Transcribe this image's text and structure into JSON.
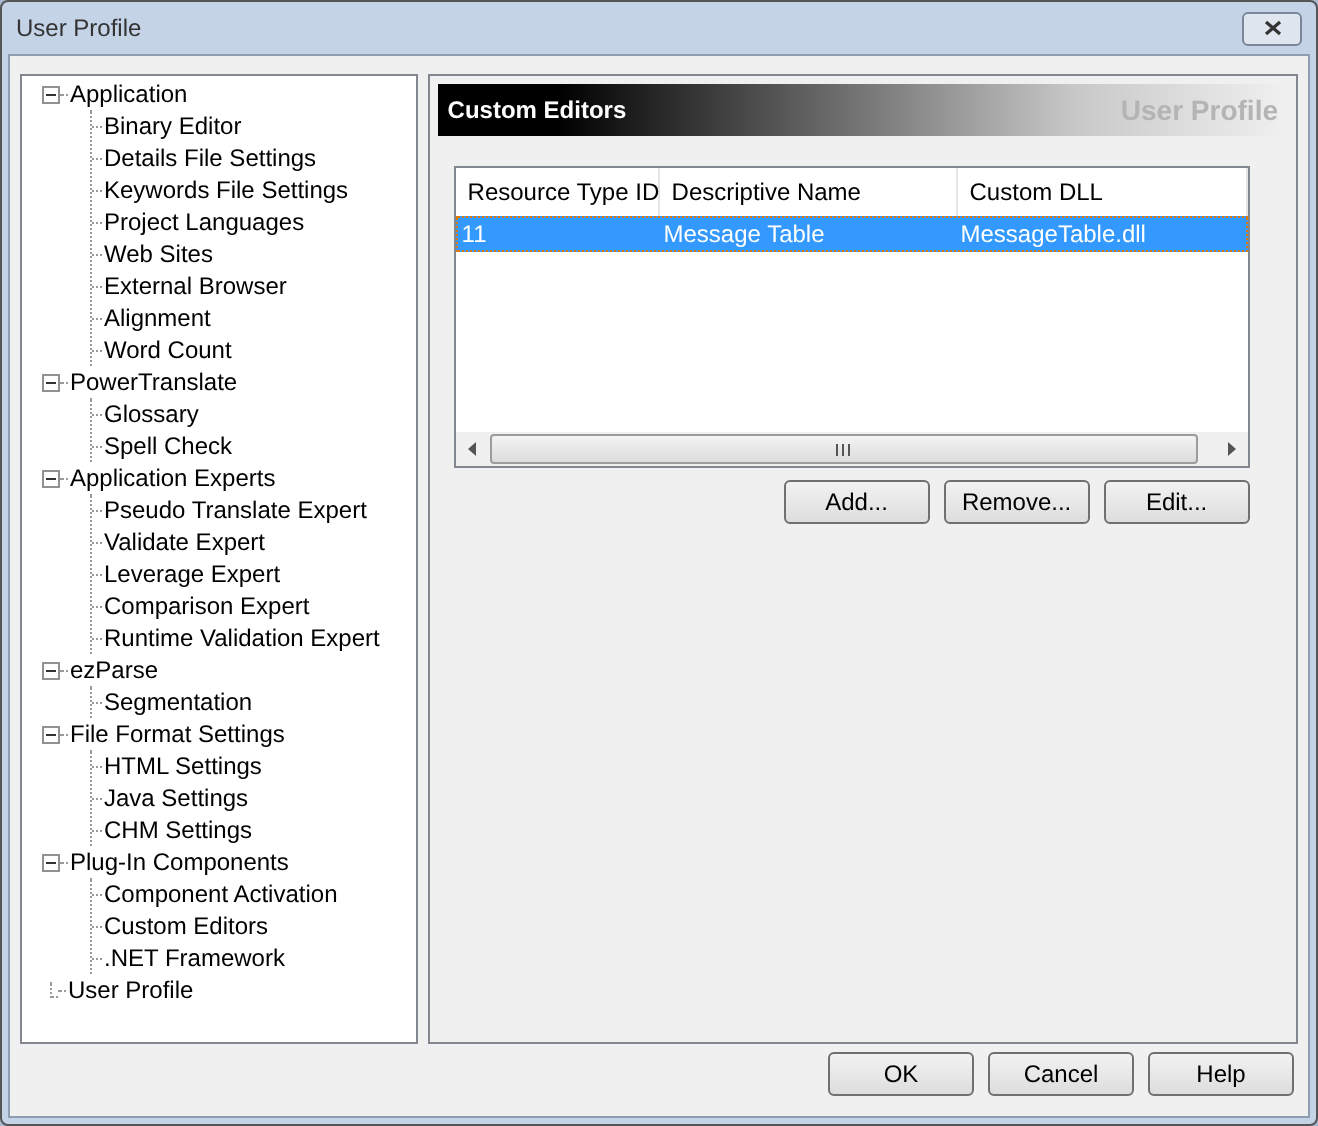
{
  "window": {
    "title": "User Profile"
  },
  "tree": [
    {
      "label": "Application",
      "expanded": true,
      "children": [
        {
          "label": "Binary Editor"
        },
        {
          "label": "Details File Settings"
        },
        {
          "label": "Keywords File Settings"
        },
        {
          "label": "Project Languages"
        },
        {
          "label": "Web Sites"
        },
        {
          "label": "External Browser"
        },
        {
          "label": "Alignment"
        },
        {
          "label": "Word Count"
        }
      ]
    },
    {
      "label": "PowerTranslate",
      "expanded": true,
      "children": [
        {
          "label": "Glossary"
        },
        {
          "label": "Spell Check"
        }
      ]
    },
    {
      "label": "Application Experts",
      "expanded": true,
      "children": [
        {
          "label": "Pseudo Translate Expert"
        },
        {
          "label": "Validate Expert"
        },
        {
          "label": "Leverage Expert"
        },
        {
          "label": "Comparison Expert"
        },
        {
          "label": "Runtime Validation Expert"
        }
      ]
    },
    {
      "label": "ezParse",
      "expanded": true,
      "children": [
        {
          "label": "Segmentation"
        }
      ]
    },
    {
      "label": "File Format Settings",
      "expanded": true,
      "children": [
        {
          "label": "HTML Settings"
        },
        {
          "label": "Java Settings"
        },
        {
          "label": "CHM Settings"
        }
      ]
    },
    {
      "label": "Plug-In Components",
      "expanded": true,
      "children": [
        {
          "label": "Component Activation"
        },
        {
          "label": "Custom Editors"
        },
        {
          "label": ".NET Framework"
        }
      ]
    },
    {
      "label": "User Profile"
    }
  ],
  "panel": {
    "title": "Custom Editors",
    "subtitle": "User Profile"
  },
  "table": {
    "columns": [
      "Resource Type ID",
      "Descriptive Name",
      "Custom DLL"
    ],
    "rows": [
      {
        "cells": [
          "11",
          "Message Table",
          "MessageTable.dll"
        ],
        "selected": true
      }
    ]
  },
  "panel_buttons": [
    "Add...",
    "Remove...",
    "Edit..."
  ],
  "buttons": [
    "OK",
    "Cancel",
    "Help"
  ]
}
